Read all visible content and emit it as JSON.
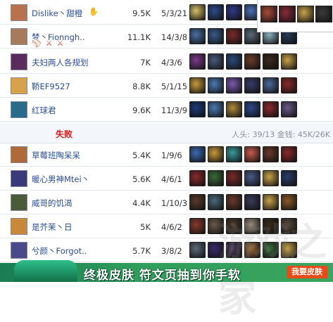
{
  "win_rows": [
    {
      "name": "Dislike丶甜橙",
      "tag_icons": "✋",
      "gold": "9.5K",
      "kda": "5/3/21",
      "avatar_color": "#b8734e",
      "items": [
        "#d8c06a",
        "#2b4c8c",
        "#2e3a8a",
        "#4d6fb5",
        "#7a8fb0",
        "#c79a3a"
      ]
    },
    {
      "name": "梦丶Fionngh..",
      "tag_icons": "⚾⚔⚔",
      "gold": "11.1K",
      "kda": "14/3/8",
      "avatar_color": "#a67b5b",
      "items": [
        "#4a6fa5",
        "#3a5a8a",
        "#7a2a2a",
        "#5a6a7a",
        "#8ab0c0",
        "#2a3a5a"
      ]
    },
    {
      "name": "夫妇两人各规划",
      "tag_icons": "",
      "gold": "7K",
      "kda": "4/3/6",
      "avatar_color": "#5a2c5e",
      "items": [
        "#7a3a8a",
        "#4a5a7a",
        "#2a4a7a",
        "#6a3a2a",
        "#3a2a1a",
        "#c9a24a"
      ]
    },
    {
      "name": "鞒EF9527",
      "tag_icons": "",
      "gold": "8.8K",
      "kda": "5/1/15",
      "avatar_color": "#d8a24a",
      "items": [
        "#c89a3a",
        "#4a7ab0",
        "#7a5ab0",
        "#3a3a6a",
        "#4a6a9a",
        "#8a2a2a"
      ]
    },
    {
      "name": "红球君",
      "tag_icons": "",
      "gold": "9.6K",
      "kda": "11/3/9",
      "avatar_color": "#2a6a8a",
      "items": [
        "#1a3a7a",
        "#4a7ab0",
        "#b08a3a",
        "#2a4a8a",
        "#8a2a2a",
        "#6a5a8a"
      ]
    }
  ],
  "section": {
    "label": "失败",
    "stats": "人头: 39/13 金钱: 45K/26K"
  },
  "lose_rows": [
    {
      "name": "草莓班陶呆呆",
      "gold": "5.4K",
      "kda": "1/9/6",
      "avatar_color": "#b06a3a",
      "items": [
        "#3a6ab0",
        "#c89a3a",
        "#3a9a9a",
        "#c85a4a",
        "#6a3a2a",
        "#8a2a2a"
      ]
    },
    {
      "name": "暖心男神Mtei丶",
      "gold": "5.6K",
      "kda": "4/6/1",
      "avatar_color": "#3a3a7a",
      "items": [
        "#8a2a2a",
        "#3a6a3a",
        "#7a2a2a",
        "#4a5a8a",
        "#c8a24a",
        "#2a3a6a"
      ]
    },
    {
      "name": "威哥的饥渴",
      "gold": "4.4K",
      "kda": "1/10/3",
      "avatar_color": "#4a5a3a",
      "items": [
        "#5a3a2a",
        "#4a6a7a",
        "#6a3a2a",
        "#3a3a5a",
        "#c8a24a",
        "#8a5a2a"
      ]
    },
    {
      "name": "是芥茉丶日",
      "gold": "5K",
      "kda": "4/6/2",
      "avatar_color": "#c88a3a",
      "items": [
        "#8a3a2a",
        "#6a5a4a",
        "#4a3a2a",
        "#9a8a7a",
        "#3a2a1a",
        "#5a4a3a"
      ]
    },
    {
      "name": "兮颜丶Forgot..",
      "gold": "5.7K",
      "kda": "3/8/2",
      "avatar_color": "#4a4a8a",
      "items": [
        "#5a6a7a",
        "#3a2a6a",
        "#4a3a5a",
        "#9a6a3a",
        "#3a6a3a",
        "#c8a24a"
      ]
    }
  ],
  "popup_items": [
    "#a84a3a",
    "#8a2a3a",
    "#c8a24a",
    "#3a3a3a"
  ],
  "banner": {
    "text": "终极皮肤 符文页抽到你手软",
    "button": "我要皮肤"
  },
  "watermark": "游戏之家"
}
